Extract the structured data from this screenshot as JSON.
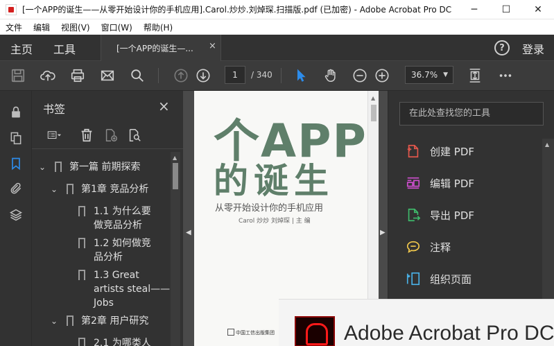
{
  "window": {
    "title": "[一个APP的诞生——从零开始设计你的手机应用].Carol.炒炒.刘焯琛.扫描版.pdf  (已加密) - Adobe Acrobat Pro DC",
    "min_glyph": "─",
    "max_glyph": "☐",
    "close_glyph": "✕"
  },
  "menu": [
    "文件",
    "编辑",
    "视图(V)",
    "窗口(W)",
    "帮助(H)"
  ],
  "topnav": {
    "home": "主页",
    "tools": "工具",
    "doc_tab": "[一个APP的诞生—...",
    "doc_tab_close": "×",
    "help": "?",
    "login": "登录"
  },
  "toolbar": {
    "page_current": "1",
    "page_total": "/ 340",
    "zoom": "36.7%",
    "zoom_caret": "▼"
  },
  "bookmarks": {
    "title": "书签",
    "close": "×",
    "items": [
      {
        "text": "第一篇   前期探索",
        "chev": "⌄"
      },
      {
        "text": "第1章   竞品分析",
        "chev": "⌄"
      },
      {
        "text": "1.1    为什么要\n做竞品分析",
        "chev": ""
      },
      {
        "text": "1.2    如何做竞\n品分析",
        "chev": ""
      },
      {
        "text": "1.3    Great\nartists steal——\nJobs",
        "chev": ""
      },
      {
        "text": "第2章   用户研究",
        "chev": "⌄"
      },
      {
        "text": "2.1    为哪类人",
        "chev": ""
      }
    ],
    "scroll_up": "▲"
  },
  "document": {
    "cover_title_line1": "个APP",
    "cover_title_line2": "的诞生",
    "cover_subtitle": "从零开始设计你的手机应用",
    "cover_authors": "Carol 炒炒   刘焯琛 | 主 编",
    "cover_publisher": "中国工信出版集团",
    "collapse_left": "◀",
    "collapse_right": "▶",
    "scroll_up": "▲"
  },
  "tools_panel": {
    "search_placeholder": "在此处查找您的工具",
    "items": [
      {
        "label": "创建 PDF",
        "icon": "create-pdf-icon",
        "color": "#e2574c"
      },
      {
        "label": "编辑 PDF",
        "icon": "edit-pdf-icon",
        "color": "#d04fd0"
      },
      {
        "label": "导出 PDF",
        "icon": "export-pdf-icon",
        "color": "#3fba6b"
      },
      {
        "label": "注释",
        "icon": "comment-icon",
        "color": "#f2c94c"
      },
      {
        "label": "组织页面",
        "icon": "organize-pages-icon",
        "color": "#4ab2e8"
      }
    ],
    "scroll_up": "▲"
  },
  "splash": {
    "text": "Adobe Acrobat Pro DC"
  }
}
